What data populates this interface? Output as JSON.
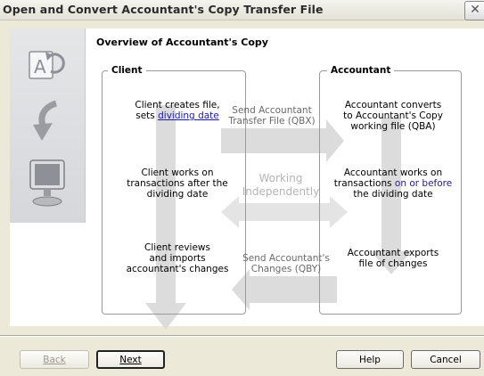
{
  "window": {
    "title": "Open and Convert Accountant's Copy Transfer File"
  },
  "heading": "Overview of Accountant's Copy",
  "panels": {
    "client": "Client",
    "accountant": "Accountant"
  },
  "client_steps": {
    "s1_line1": "Client creates file,",
    "s1_line2_prefix": "sets ",
    "s1_link": "dividing date",
    "s2_line1": "Client works on",
    "s2_line2": "transactions after the",
    "s2_line3": "dividing date",
    "s3_line1": "Client reviews",
    "s3_line2": "and imports",
    "s3_line3": "accountant's changes"
  },
  "accountant_steps": {
    "s1_line1": "Accountant converts",
    "s1_line2": "to Accountant's Copy",
    "s1_line3": "working file (QBA)",
    "s2_line1": "Accountant works on",
    "s2_line2_prefix": "transactions ",
    "s2_highlight": "on or before",
    "s2_line3": "the dividing date",
    "s3_line1": "Accountant exports",
    "s3_line2": "file of changes"
  },
  "arrows": {
    "send_qbx_line1": "Send Accountant",
    "send_qbx_line2": "Transfer File (QBX)",
    "working_line1": "Working",
    "working_line2": "Independently",
    "send_qby_line1": "Send Accountant's",
    "send_qby_line2": "Changes (QBY)"
  },
  "buttons": {
    "back": "Back",
    "next": "Next",
    "help": "Help",
    "cancel": "Cancel"
  },
  "sidebar_icons": [
    "document-a-icon",
    "curved-arrow-icon",
    "computer-monitor-icon"
  ]
}
